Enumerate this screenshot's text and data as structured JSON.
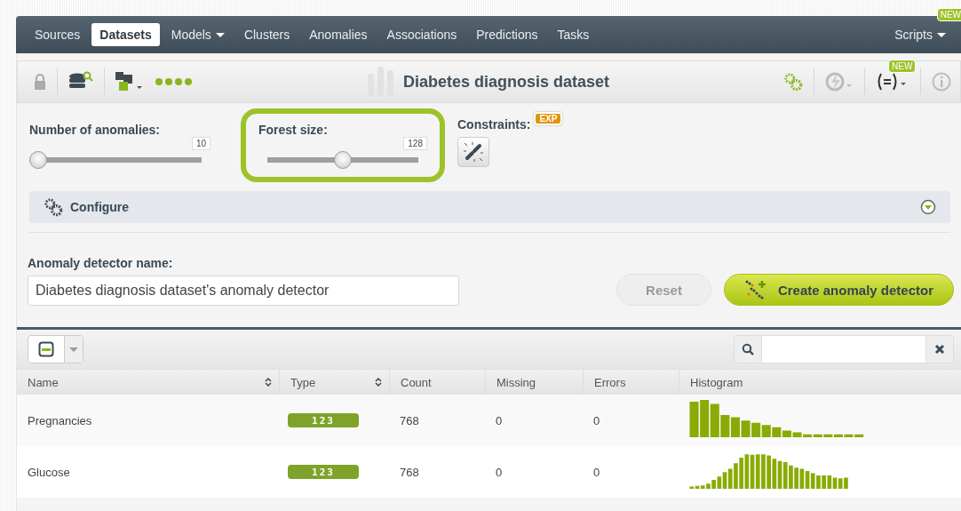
{
  "nav": {
    "items": [
      {
        "label": "Sources",
        "selected": false,
        "dropdown": false
      },
      {
        "label": "Datasets",
        "selected": true,
        "dropdown": false
      },
      {
        "label": "Models",
        "selected": false,
        "dropdown": true
      },
      {
        "label": "Clusters",
        "selected": false,
        "dropdown": false
      },
      {
        "label": "Anomalies",
        "selected": false,
        "dropdown": false
      },
      {
        "label": "Associations",
        "selected": false,
        "dropdown": false
      },
      {
        "label": "Predictions",
        "selected": false,
        "dropdown": false
      },
      {
        "label": "Tasks",
        "selected": false,
        "dropdown": false
      }
    ],
    "right_item": {
      "label": "Scripts",
      "badge": "NEW"
    }
  },
  "toolbar": {
    "title": "Diabetes diagnosis dataset",
    "badge": "NEW"
  },
  "settings": {
    "sliders": [
      {
        "label": "Number of anomalies:",
        "value": "10",
        "level": 0,
        "highlighted": false
      },
      {
        "label": "Forest size:",
        "value": "128",
        "level": 0.5,
        "highlighted": true
      }
    ],
    "constraints": {
      "label": "Constraints:",
      "badge": "EXP"
    },
    "configure": {
      "label": "Configure",
      "expanded": false
    }
  },
  "name_field": {
    "label": "Anomaly detector name:",
    "value": "Diabetes diagnosis dataset's anomaly detector"
  },
  "buttons": [
    {
      "label": "Reset",
      "kind": "secondary",
      "disabled": true
    },
    {
      "label": "Create anomaly detector",
      "kind": "primary",
      "disabled": false
    }
  ],
  "table": {
    "columns": [
      {
        "label": "Name",
        "sortable": true
      },
      {
        "label": "Type",
        "sortable": true
      },
      {
        "label": "Count",
        "sortable": false
      },
      {
        "label": "Missing",
        "sortable": false
      },
      {
        "label": "Errors",
        "sortable": false
      },
      {
        "label": "Histogram",
        "sortable": false
      }
    ],
    "rows": [
      {
        "name": "Pregnancies",
        "type": "123",
        "count": "768",
        "missing": "0",
        "errors": "0",
        "histogram": {
          "kind": "skewed"
        }
      },
      {
        "name": "Glucose",
        "type": "123",
        "count": "768",
        "missing": "0",
        "errors": "0",
        "histogram": {
          "kind": "bell"
        }
      }
    ]
  }
}
